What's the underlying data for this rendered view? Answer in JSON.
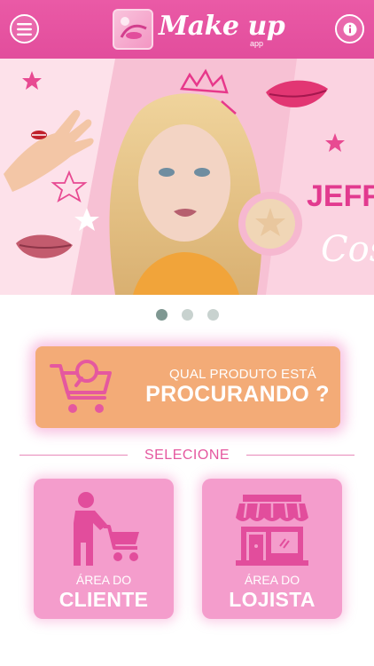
{
  "header": {
    "logo_text": "Make up",
    "logo_sub": "app",
    "menu_icon": "menu-icon",
    "info_icon": "info-icon"
  },
  "banner": {
    "text_top": "JEFF",
    "text_bottom": "Cos"
  },
  "carousel": {
    "pages": 3,
    "active_index": 0
  },
  "search": {
    "line1": "QUAL PRODUTO ESTÁ",
    "line2": "PROCURANDO ?",
    "icon": "shopping-cart-search-icon"
  },
  "select_label": "SELECIONE",
  "areas": [
    {
      "line1": "ÁREA DO",
      "line2": "CLIENTE",
      "icon": "customer-cart-icon"
    },
    {
      "line1": "ÁREA DO",
      "line2": "LOJISTA",
      "icon": "storefront-icon"
    }
  ],
  "colors": {
    "header": "#e24d9c",
    "search_card": "#f3ab77",
    "area_card": "#f49dcc",
    "accent_text": "#e5579f",
    "dot_active": "#7f9892",
    "dot_inactive": "#c8d2cf"
  }
}
